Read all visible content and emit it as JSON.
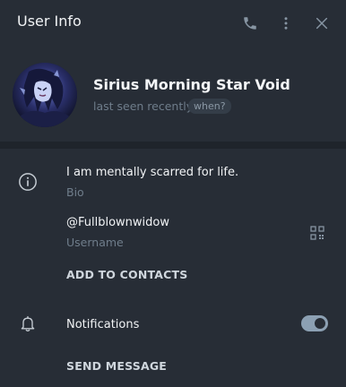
{
  "header": {
    "title": "User Info",
    "icons": [
      "phone-icon",
      "more-vertical-icon",
      "close-icon"
    ]
  },
  "profile": {
    "name": "Sirius Morning Star Void",
    "status": "last seen recently",
    "when_label": "when?"
  },
  "info": {
    "bio_text": "I am mentally scarred for life.",
    "bio_label": "Bio",
    "username_text": "@Fullblownwidow",
    "username_label": "Username",
    "add_contacts": "ADD TO CONTACTS"
  },
  "notifications": {
    "label": "Notifications",
    "enabled": true
  },
  "send_message": "SEND MESSAGE",
  "colors": {
    "background": "#272d36",
    "divider": "#1f242b",
    "muted": "#6f7d8b",
    "toggle": "#8ca0b3"
  }
}
